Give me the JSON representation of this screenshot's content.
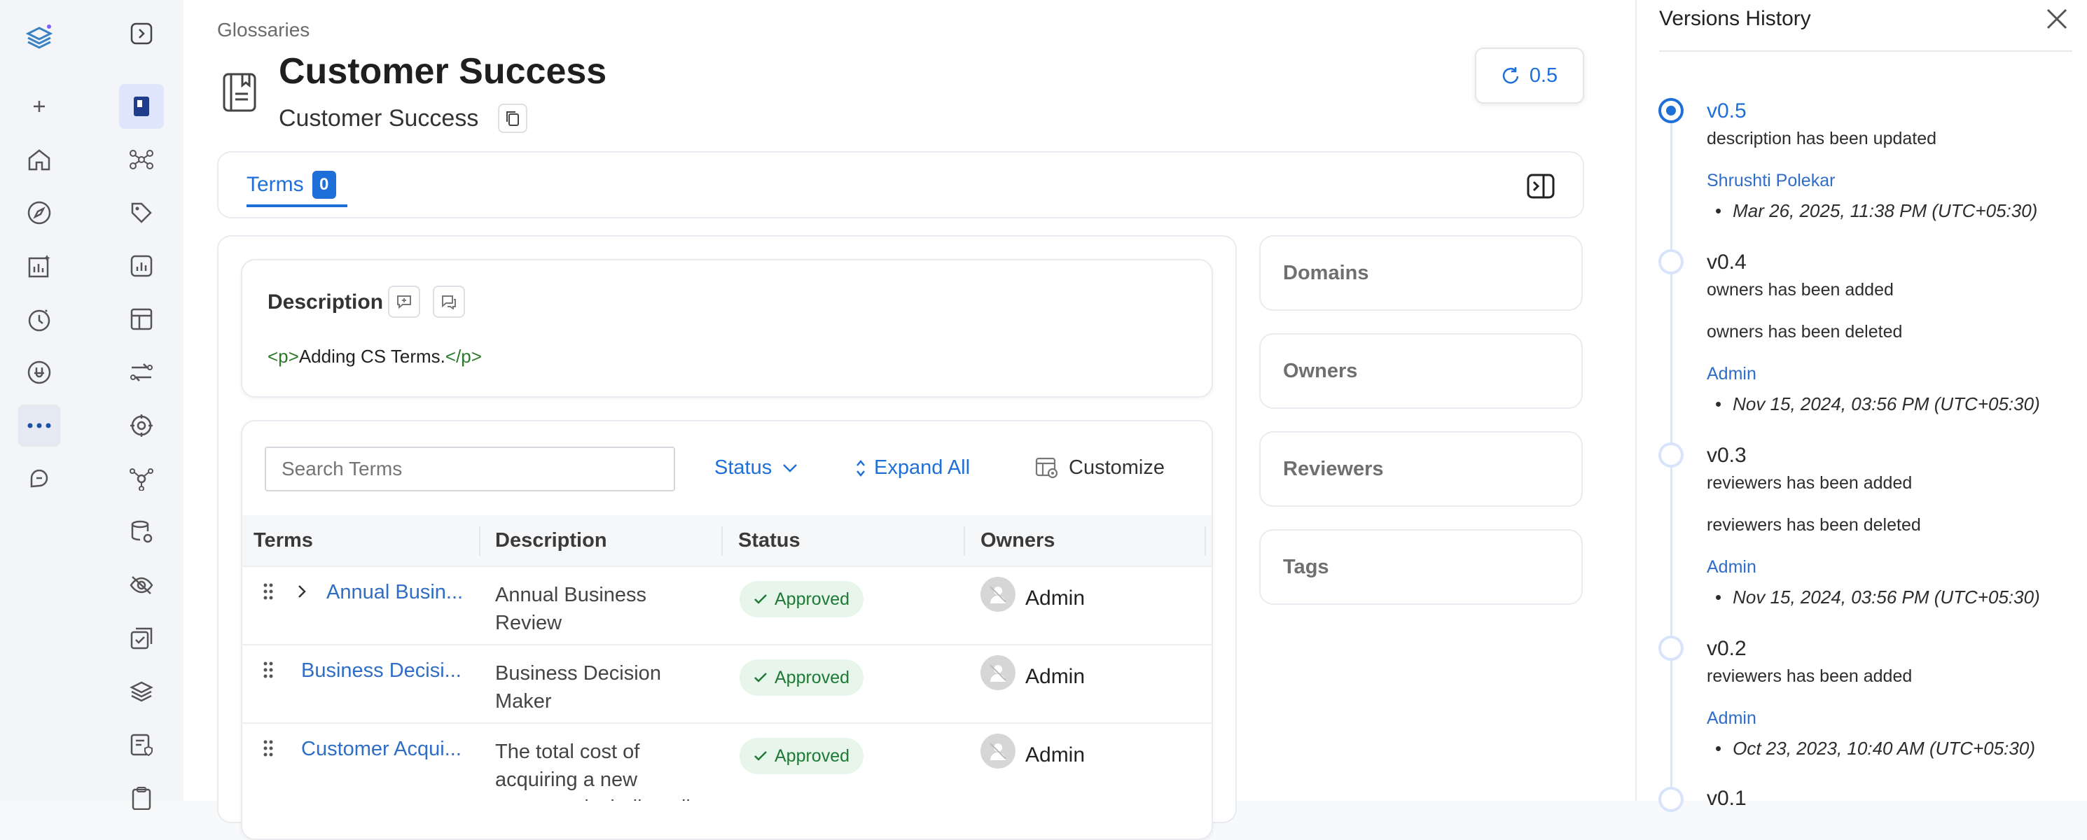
{
  "breadcrumb": "Glossaries",
  "glossary": {
    "title": "Customer Success",
    "display_name": "Customer Success",
    "version_button": "0.5"
  },
  "tabs": [
    {
      "label": "Terms",
      "count": "0"
    }
  ],
  "description": {
    "heading": "Description",
    "open_tag": "<p>",
    "text": "Adding CS Terms.",
    "close_tag": "</p>"
  },
  "terms_toolbar": {
    "search_placeholder": "Search Terms",
    "status_label": "Status",
    "expand_label": "Expand All",
    "customize_label": "Customize"
  },
  "table": {
    "headers": [
      "Terms",
      "Description",
      "Status",
      "Owners"
    ],
    "rows": [
      {
        "term": "Annual Busin...",
        "desc1": "Annual Business",
        "desc2": "Review",
        "status": "Approved",
        "owner": "Admin"
      },
      {
        "term": "Business Decisi...",
        "desc1": "Business Decision",
        "desc2": "Maker",
        "status": "Approved",
        "owner": "Admin"
      },
      {
        "term": "Customer Acqui...",
        "desc1": "The total cost of",
        "desc2": "acquiring a new",
        "desc3": "customer including all",
        "status": "Approved",
        "owner": "Admin"
      }
    ]
  },
  "side_cards": [
    "Domains",
    "Owners",
    "Reviewers",
    "Tags"
  ],
  "versions": {
    "title": "Versions History",
    "items": [
      {
        "version": "v0.5",
        "changes": [
          "description has been updated"
        ],
        "user": "Shrushti Polekar",
        "date": "Mar 26, 2025, 11:38 PM (UTC+05:30)"
      },
      {
        "version": "v0.4",
        "changes": [
          "owners has been added",
          "owners has been deleted"
        ],
        "user": "Admin",
        "date": "Nov 15, 2024, 03:56 PM (UTC+05:30)"
      },
      {
        "version": "v0.3",
        "changes": [
          "reviewers has been added",
          "reviewers has been deleted"
        ],
        "user": "Admin",
        "date": "Nov 15, 2024, 03:56 PM (UTC+05:30)"
      },
      {
        "version": "v0.2",
        "changes": [
          "reviewers has been added"
        ],
        "user": "Admin",
        "date": "Oct 23, 2023, 10:40 AM (UTC+05:30)"
      },
      {
        "version": "v0.1"
      }
    ]
  },
  "colors": {
    "accent": "#1f6fd8",
    "approved_bg": "#e8f5ea",
    "approved_text": "#1d7a36",
    "code_tag": "#2a7a2a"
  }
}
